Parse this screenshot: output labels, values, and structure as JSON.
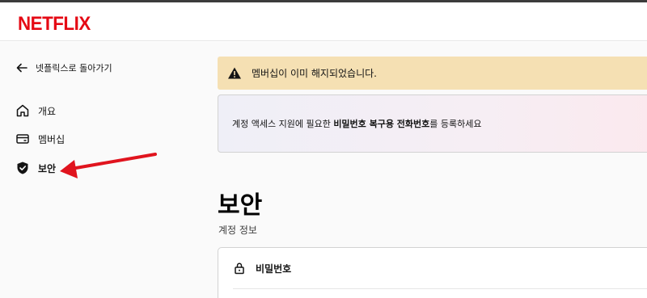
{
  "header": {
    "logo_text": "NETFLIX",
    "brand_color": "#e50914"
  },
  "sidebar": {
    "back_label": "넷플릭스로 돌아가기",
    "items": [
      {
        "label": "개요",
        "icon": "home-icon"
      },
      {
        "label": "멤버십",
        "icon": "card-icon"
      },
      {
        "label": "보안",
        "icon": "shield-check-icon",
        "active": true
      }
    ]
  },
  "annotation": {
    "arrow_color": "#e0141e"
  },
  "main": {
    "warning_banner": {
      "icon": "warning-icon",
      "text": "멤버십이 이미 해지되었습니다.",
      "background": "#f5e0b3"
    },
    "info_banner": {
      "text_before": "계정 액세스 지원에 필요한 ",
      "text_bold": "비밀번호 복구용 전화번호",
      "text_after": "를 등록하세요"
    },
    "page_title": "보안",
    "section_label": "계정 정보",
    "account_rows": [
      {
        "label": "비밀번호",
        "icon": "lock-icon"
      }
    ]
  }
}
